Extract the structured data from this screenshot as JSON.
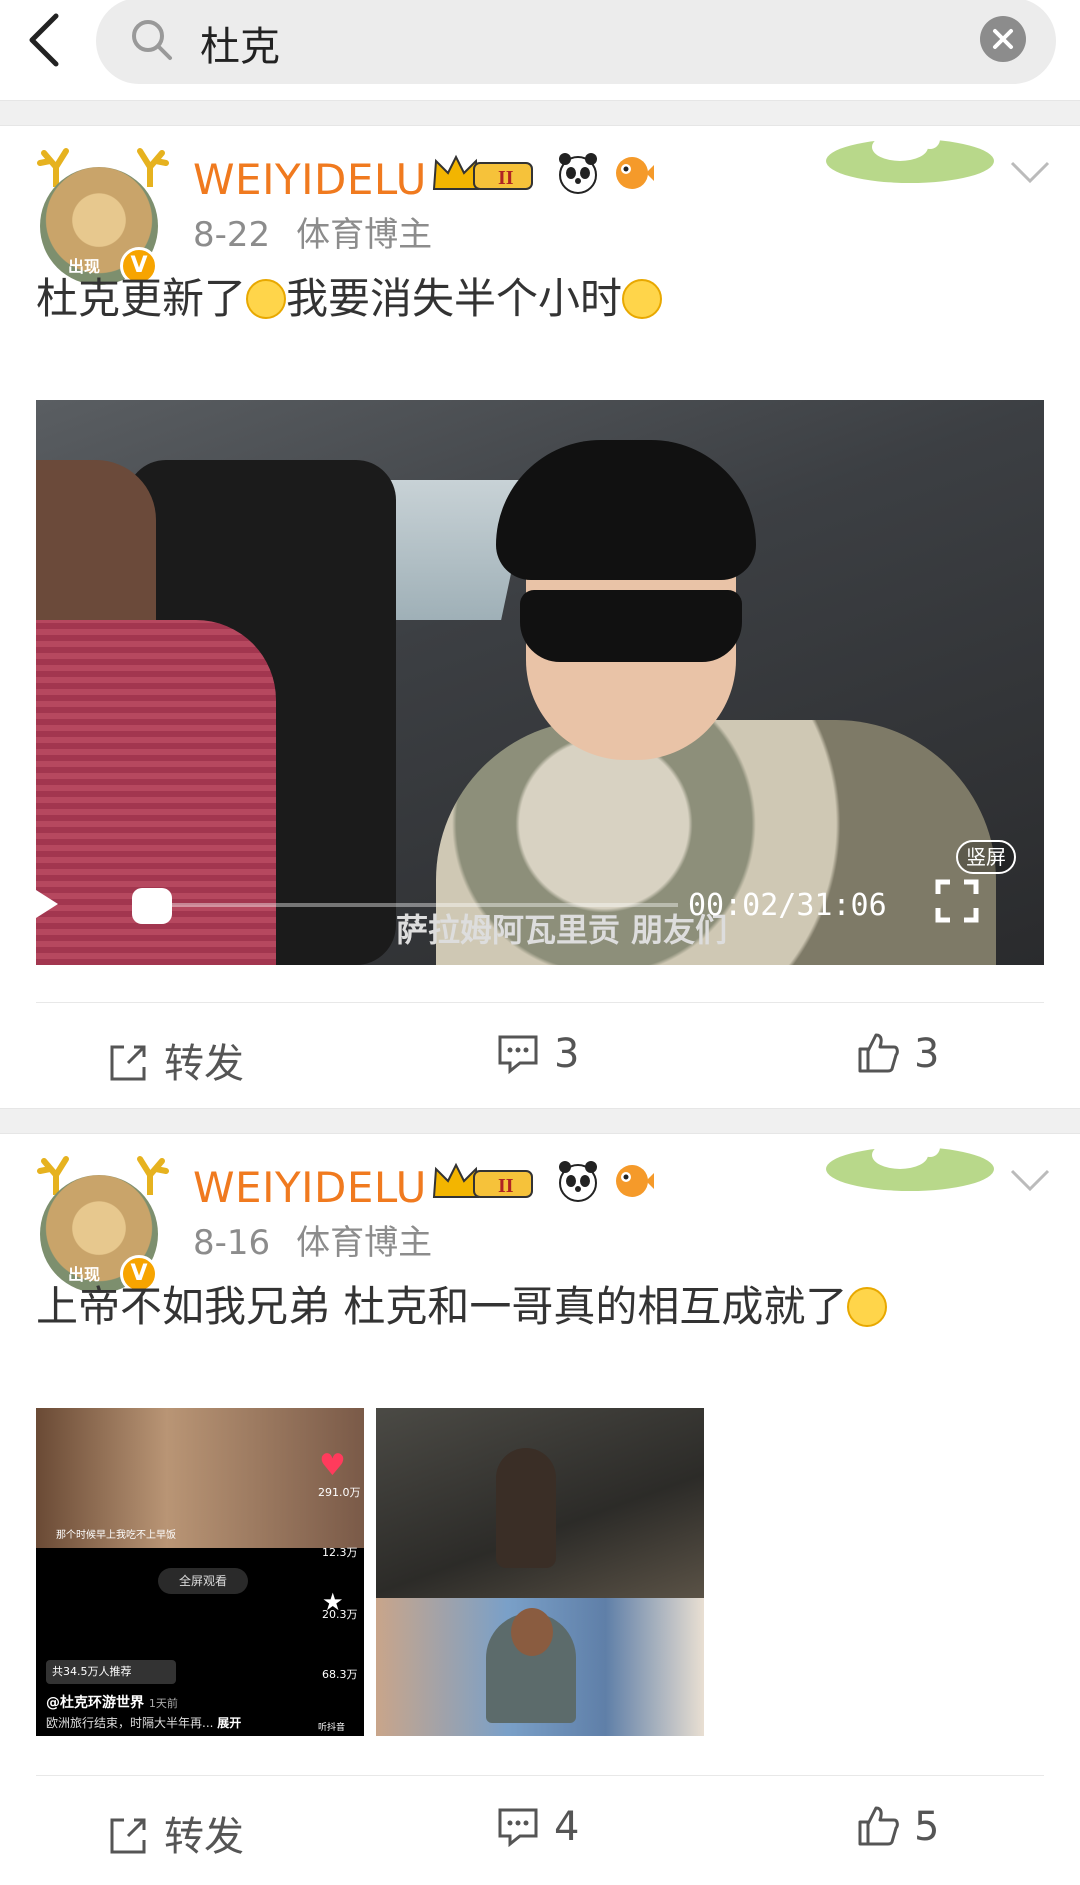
{
  "search": {
    "query": "杜克"
  },
  "posts": [
    {
      "username": "WEIYIDELU",
      "date": "8-22",
      "role": "体育博主",
      "avatar_tag": "出现",
      "text": "杜克更新了",
      "text2": "我要消失半个小时",
      "video": {
        "caption": "萨拉姆阿瓦里贡 朋友们",
        "time": "00:02/31:06",
        "vertical_label": "竖屏",
        "progress": 0.001
      },
      "actions": {
        "repost": "转发",
        "comments": "3",
        "likes": "3"
      }
    },
    {
      "username": "WEIYIDELU",
      "date": "8-16",
      "role": "体育博主",
      "avatar_tag": "出现",
      "text": "上帝不如我兄弟  杜克和一哥真的相互成就了",
      "image1": {
        "likes": "291.0万",
        "count2": "12.3万",
        "count3": "20.3万",
        "count4": "68.3万",
        "fullscreen": "全屏观看",
        "recommend": "共34.5万人推荐",
        "account": "@杜克环游世界",
        "account_time": "1天前",
        "desc": "欧洲旅行结束，时隔大半年再...",
        "desc_more": "展开",
        "subtitle": "那个时候早上我吃不上早饭",
        "listen": "听抖音"
      },
      "actions": {
        "repost": "转发",
        "comments": "4",
        "likes": "5"
      }
    }
  ],
  "colors": {
    "username": "#f07a1f",
    "meta": "#8c8c8c",
    "accent_orange": "#f7a400"
  },
  "icons": [
    "back-icon",
    "search-icon",
    "clear-icon",
    "chevron-down-icon",
    "repost-icon",
    "comment-icon",
    "like-icon",
    "fullscreen-icon",
    "vip-crown-icon",
    "panda-icon",
    "pufferfish-icon"
  ]
}
